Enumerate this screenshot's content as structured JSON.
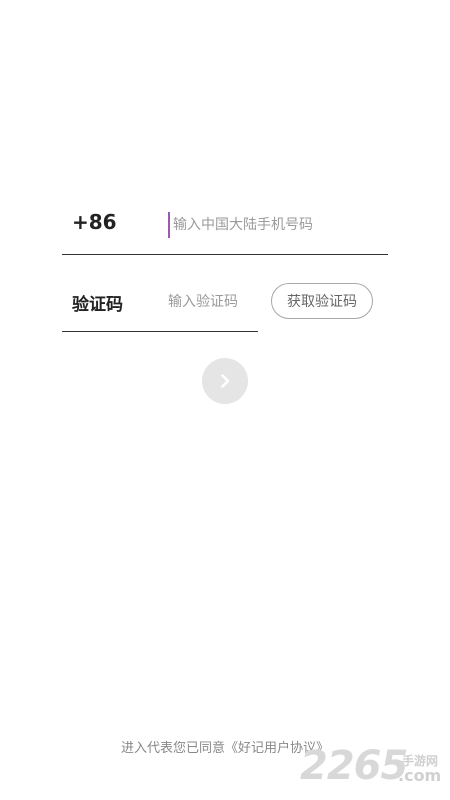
{
  "phone": {
    "country_code": "+86",
    "placeholder": "输入中国大陆手机号码",
    "value": ""
  },
  "verification": {
    "label": "验证码",
    "placeholder": "输入验证码",
    "value": "",
    "get_code_label": "获取验证码"
  },
  "next": {
    "icon": "chevron-right-icon",
    "background": "#e5e5e5"
  },
  "agreement": {
    "prefix": "进入代表您已同意",
    "link_text": "《好记用户协议》"
  },
  "watermark": {
    "number": "2265",
    "cn_text": "手游网",
    "domain": ".com"
  },
  "colors": {
    "cursor_accent": "#9b59b6",
    "divider": "#333333"
  }
}
